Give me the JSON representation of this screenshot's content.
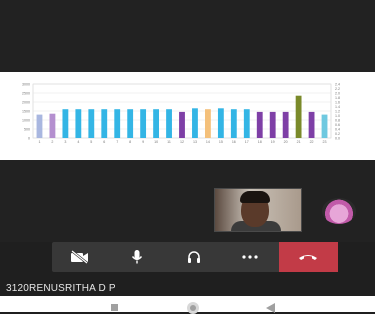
{
  "participant": {
    "name": "3120RENUSRITHA D P"
  },
  "shared_screen": {
    "chart_data": {
      "type": "bar",
      "categories": [
        "1",
        "2",
        "3",
        "4",
        "5",
        "6",
        "7",
        "8",
        "9",
        "10",
        "11",
        "12",
        "13",
        "14",
        "15",
        "16",
        "17",
        "18",
        "19",
        "20",
        "21",
        "22",
        "23"
      ],
      "values": [
        1300,
        1350,
        1600,
        1600,
        1600,
        1600,
        1600,
        1600,
        1600,
        1600,
        1600,
        1450,
        1650,
        1600,
        1650,
        1600,
        1600,
        1450,
        1450,
        1450,
        2350,
        1450,
        1300
      ],
      "series_colors": [
        "#a9b7e0",
        "#b48fcf",
        "#33b5e5",
        "#33b5e5",
        "#33b5e5",
        "#33b5e5",
        "#33b5e5",
        "#33b5e5",
        "#33b5e5",
        "#33b5e5",
        "#33b5e5",
        "#7e3fa6",
        "#33b5e5",
        "#f4c07a",
        "#33b5e5",
        "#33b5e5",
        "#33b5e5",
        "#7e3fa6",
        "#7e3fa6",
        "#7e3fa6",
        "#7a8a2a",
        "#7e3fa6",
        "#6fc9e0"
      ],
      "ylim": [
        0,
        3000
      ],
      "yticks": [
        "0",
        "500",
        "1000",
        "1500",
        "2000",
        "2500",
        "3000"
      ],
      "y2ticks": [
        "0.0",
        "0.2",
        "0.4",
        "0.6",
        "0.8",
        "1.0",
        "1.2",
        "1.4",
        "1.6",
        "1.8",
        "2.0",
        "2.2",
        "2.4"
      ],
      "grid": true
    }
  },
  "controls": {
    "video_icon": "video-off-icon",
    "mic_icon": "microphone-icon",
    "audio_icon": "headphones-icon",
    "more_icon": "more-icon",
    "hangup_icon": "hangup-icon",
    "hangup_color": "#c23b47"
  }
}
